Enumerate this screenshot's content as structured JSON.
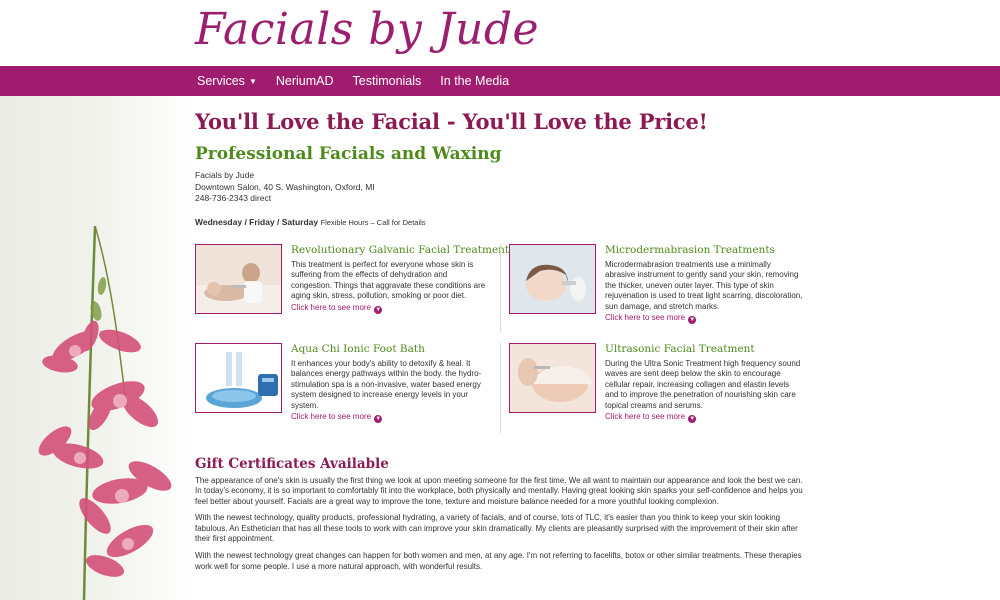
{
  "site": {
    "logo_text": "Facials by Jude"
  },
  "nav": {
    "items": [
      {
        "label": "Services",
        "has_caret": true
      },
      {
        "label": "NeriumAD"
      },
      {
        "label": "Testimonials"
      },
      {
        "label": "In the Media"
      }
    ]
  },
  "main": {
    "headline": "You'll Love the Facial - You'll Love the Price!",
    "subhead": "Professional Facials and Waxing",
    "address": {
      "name": "Facials by Jude",
      "location": "Downtown Salon, 40 S. Washington, Oxford, MI",
      "phone": "248-736-2343 direct"
    },
    "hours": {
      "days": "Wednesday / Friday / Saturday",
      "note": "Flexible Hours – Call for Details"
    },
    "services": [
      {
        "title": "Revolutionary Galvanic Facial Treatment",
        "description": "This treatment is perfect for everyone whose skin is suffering from the effects of dehydration and congestion. Things that aggravate these conditions are aging skin, stress, pollution, smoking or poor diet.",
        "link": "Click here to see more"
      },
      {
        "title": "Microdermabrasion Treatments",
        "description": "Microdermabrasion treatments use a minimally abrasive instrument to gently sand your skin, removing the thicker, uneven outer layer. This type of skin rejuvenation is used to treat light scarring, discoloration, sun damage, and stretch marks.",
        "link": "Click here to see more"
      },
      {
        "title": "Aqua Chi Ionic Foot Bath",
        "description": "It enhances your body's ability to detoxify & heal. It balances energy pathways within the body. the hydro-stimulation spa is a non-invasive, water based energy system designed to increase energy levels in your system.",
        "link": "Click here to see more"
      },
      {
        "title": "Ultrasonic Facial Treatment",
        "description": "During the Ultra Sonic Treatment high frequency sound waves are sent deep below the skin to encourage cellular repair, increasing collagen and elastin levels and to improve the penetration of nourishing skin care topical creams and serums.",
        "link": "Click here to see more"
      }
    ],
    "gift": {
      "title": "Gift Certificates Available",
      "paragraphs": [
        "The appearance of one's skin is usually the first thing we look at upon meeting someone for the first time. We all want to maintain our appearance and look the best we can. In today's economy, it is so important to comfortably fit into the workplace, both physically and mentally. Having great looking skin sparks your self-confidence and helps you feel better about yourself. Facials are a great way to improve the tone, texture and moisture balance needed for a more youthful looking complexion.",
        "With the newest technology, quality products, professional hydrating, a variety of facials, and of course, lots of TLC, it's easier than you think to keep your skin looking fabulous. An Esthetician that has all these tools to work with can improve your skin dramatically. My clients are pleasantly surprised with the improvement of their skin after their first appointment.",
        "With the newest technology great changes can happen for both women and men, at any age. I'm not referring to facelifts, botox or other similar treatments. These therapies work well for some people. I use a more natural approach, with wonderful results."
      ]
    }
  },
  "colors": {
    "brand": "#a01c6e",
    "headline": "#8b1a55",
    "accent_green": "#4e8a1c"
  },
  "icons": {
    "more_link": "circle-chevron-down-icon",
    "nav_caret": "caret-down-icon"
  }
}
